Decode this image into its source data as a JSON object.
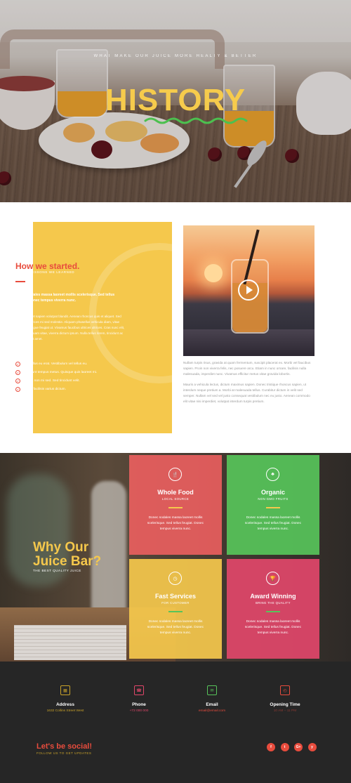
{
  "hero": {
    "tagline": "WHAT MAKE OUR JUICE MORE HEALTY & BETTER",
    "title": "HISTORY"
  },
  "story": {
    "title": "How we started.",
    "subtitle": "TIPS & LESSONS WE LEARNED",
    "bold_text": "Donec sodales massa laoreet mollis scelerisque. Sed tellus feugiat. Donec tempus viverra nunc.",
    "body_text": "Vitae sit amet sapien volutpat blandit. Aenean rhoncus quis et aliquet. Sed interdum ultrices mi sed molestie. Aliquam phasellus vehicula diam, vitae imperdiet augue feugiat ut. Vivamus faucibus ultrices ultrices. Cras nunc elit, lobortis eu quam vitae, viverra dictum ipsum. Nulla tellus lorem, tincidunt ac bibendum sit amet.",
    "bullets": [
      "Phasellus eu erat. Vestibulum vel tellus eu.",
      "Tincidunt tempus metus. Quisque quis laoreet mi.",
      "Mauris non mi sed. Sed tincidunt velit.",
      "Varius facilisis varius dictum."
    ],
    "para1": "Nullam turpis risus, gravida at quam fermentum, suscipit placerat ex. Morbi vel faucibus sapien. Proin non viverra felis, nec posuere arcu. Etiam in nunc ornare, facilisis nulla malesuada, imperdiet nunc. Vivamus efficitur metus vitae gravida lobortis.",
    "para2": "Mauris a vehicula lectus, dictum maximus sapien. Donec tristique rhoncus sapien, ut interdum neque pretium a. Morbi at malesuada tellus. Curabitur dictum in velit sed semper. Nullam vel sed vel justo consequat vestibulum nec eu justo. Aenean commodo elit vitae nisi imperdiet, volutpat interdum turpis pretium."
  },
  "why": {
    "title_line1": "Why Our",
    "title_line2": "Juice Bar?",
    "subtitle": "THE BEST QUALITY JUICE",
    "tiles": [
      {
        "title": "Whole Food",
        "subtitle": "LOCAL SOURCE",
        "body": "Donec sodales massa laoreet mollis scelerisque. Sed tellus feugiat. Donec tempus viverra nunc.",
        "icon": "utensils-icon",
        "color": "#ec5f5f",
        "line": "#f5c84c"
      },
      {
        "title": "Organic",
        "subtitle": "NON GMO FRUITS",
        "body": "Donec sodales massa laoreet mollis scelerisque. Sed tellus feugiat. Donec tempus viverra nunc.",
        "icon": "leaf-person-icon",
        "color": "#57c45a",
        "line": "#f5c84c"
      },
      {
        "title": "Fast Services",
        "subtitle": "FOR CUSTOMER",
        "body": "Donec sodales massa laoreet mollis scelerisque. Sed tellus feugiat. Donec tempus viverra nunc.",
        "icon": "timer-icon",
        "color": "#f5c84c",
        "line": "#57c45a"
      },
      {
        "title": "Award Winning",
        "subtitle": "BRING THE QUALITY",
        "body": "Donec sodales massa laoreet mollis scelerisque. Sed tellus feugiat. Donec tempus viverra nunc.",
        "icon": "trophy-icon",
        "color": "#e1476a",
        "line": "#57c45a"
      }
    ]
  },
  "footer": {
    "contacts": [
      {
        "label": "Address",
        "value": "1632 Collins Street West",
        "icon": "map-icon",
        "color": "#c9a22a"
      },
      {
        "label": "Phone",
        "value": "+72 000 000",
        "icon": "phone-icon",
        "color": "#e1476a"
      },
      {
        "label": "Email",
        "value": "email@email.com",
        "icon": "envelope-icon",
        "color": "#57c45a"
      },
      {
        "label": "Opening Time",
        "value": "10 AM – 11 PM",
        "icon": "clock-icon",
        "color": "#e84c3d"
      }
    ],
    "social_title": "Let's be social!",
    "social_subtitle": "FOLLOW US TO GET UPDATES",
    "social_icons": [
      "facebook-icon",
      "twitter-icon",
      "google-plus-icon",
      "yelp-icon"
    ]
  }
}
